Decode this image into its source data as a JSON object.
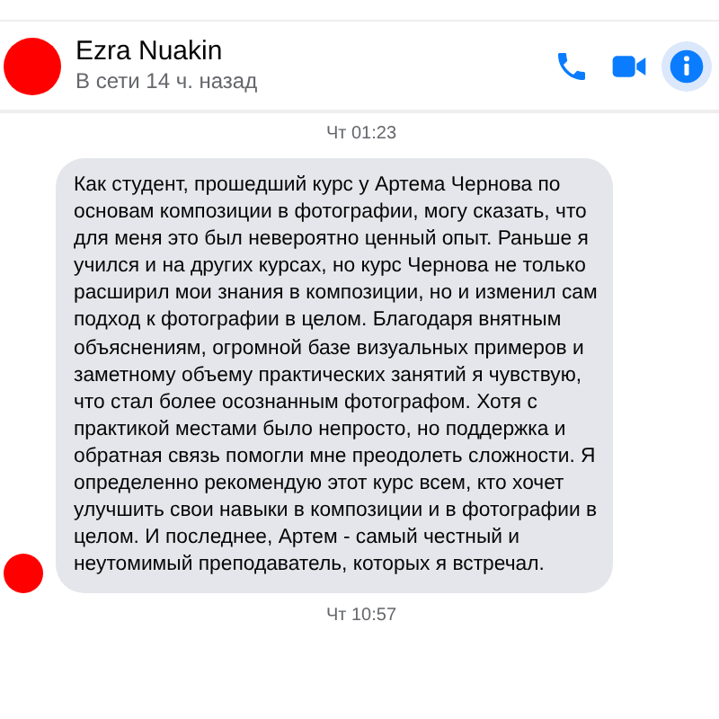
{
  "contact": {
    "name": "Ezra Nuakin",
    "status": "В сети 14 ч. назад"
  },
  "header_actions": [
    {
      "kind": "phone",
      "selected": false
    },
    {
      "kind": "video",
      "selected": false
    },
    {
      "kind": "info",
      "selected": true
    }
  ],
  "messages": [
    {
      "kind": "timestamp",
      "text": "Чт 01:23"
    },
    {
      "kind": "incoming",
      "text": "Как студент, прошедший курс у Артема Чернова по основам композиции в фотографии, могу сказать, что для меня это был невероятно ценный опыт. Раньше я учился и на других курсах, но курс Чернова не только расширил мои знания в композиции, но и изменил сам подход к фотографии в целом. Благодаря внятным объяснениям, огромной базе визуальных примеров и заметному объему практических занятий я чувствую, что стал более осознанным фотографом. Хотя с практикой местами было непросто, но поддержка и обратная связь помогли мне преодолеть сложности. Я определенно рекомендую этот курс всем, кто хочет улучшить свои навыки в композиции и в фотографии в целом. И последнее, Артем - самый честный и неутомимый преподаватель, которых я встречал."
    },
    {
      "kind": "timestamp",
      "text": "Чт 10:57"
    }
  ]
}
